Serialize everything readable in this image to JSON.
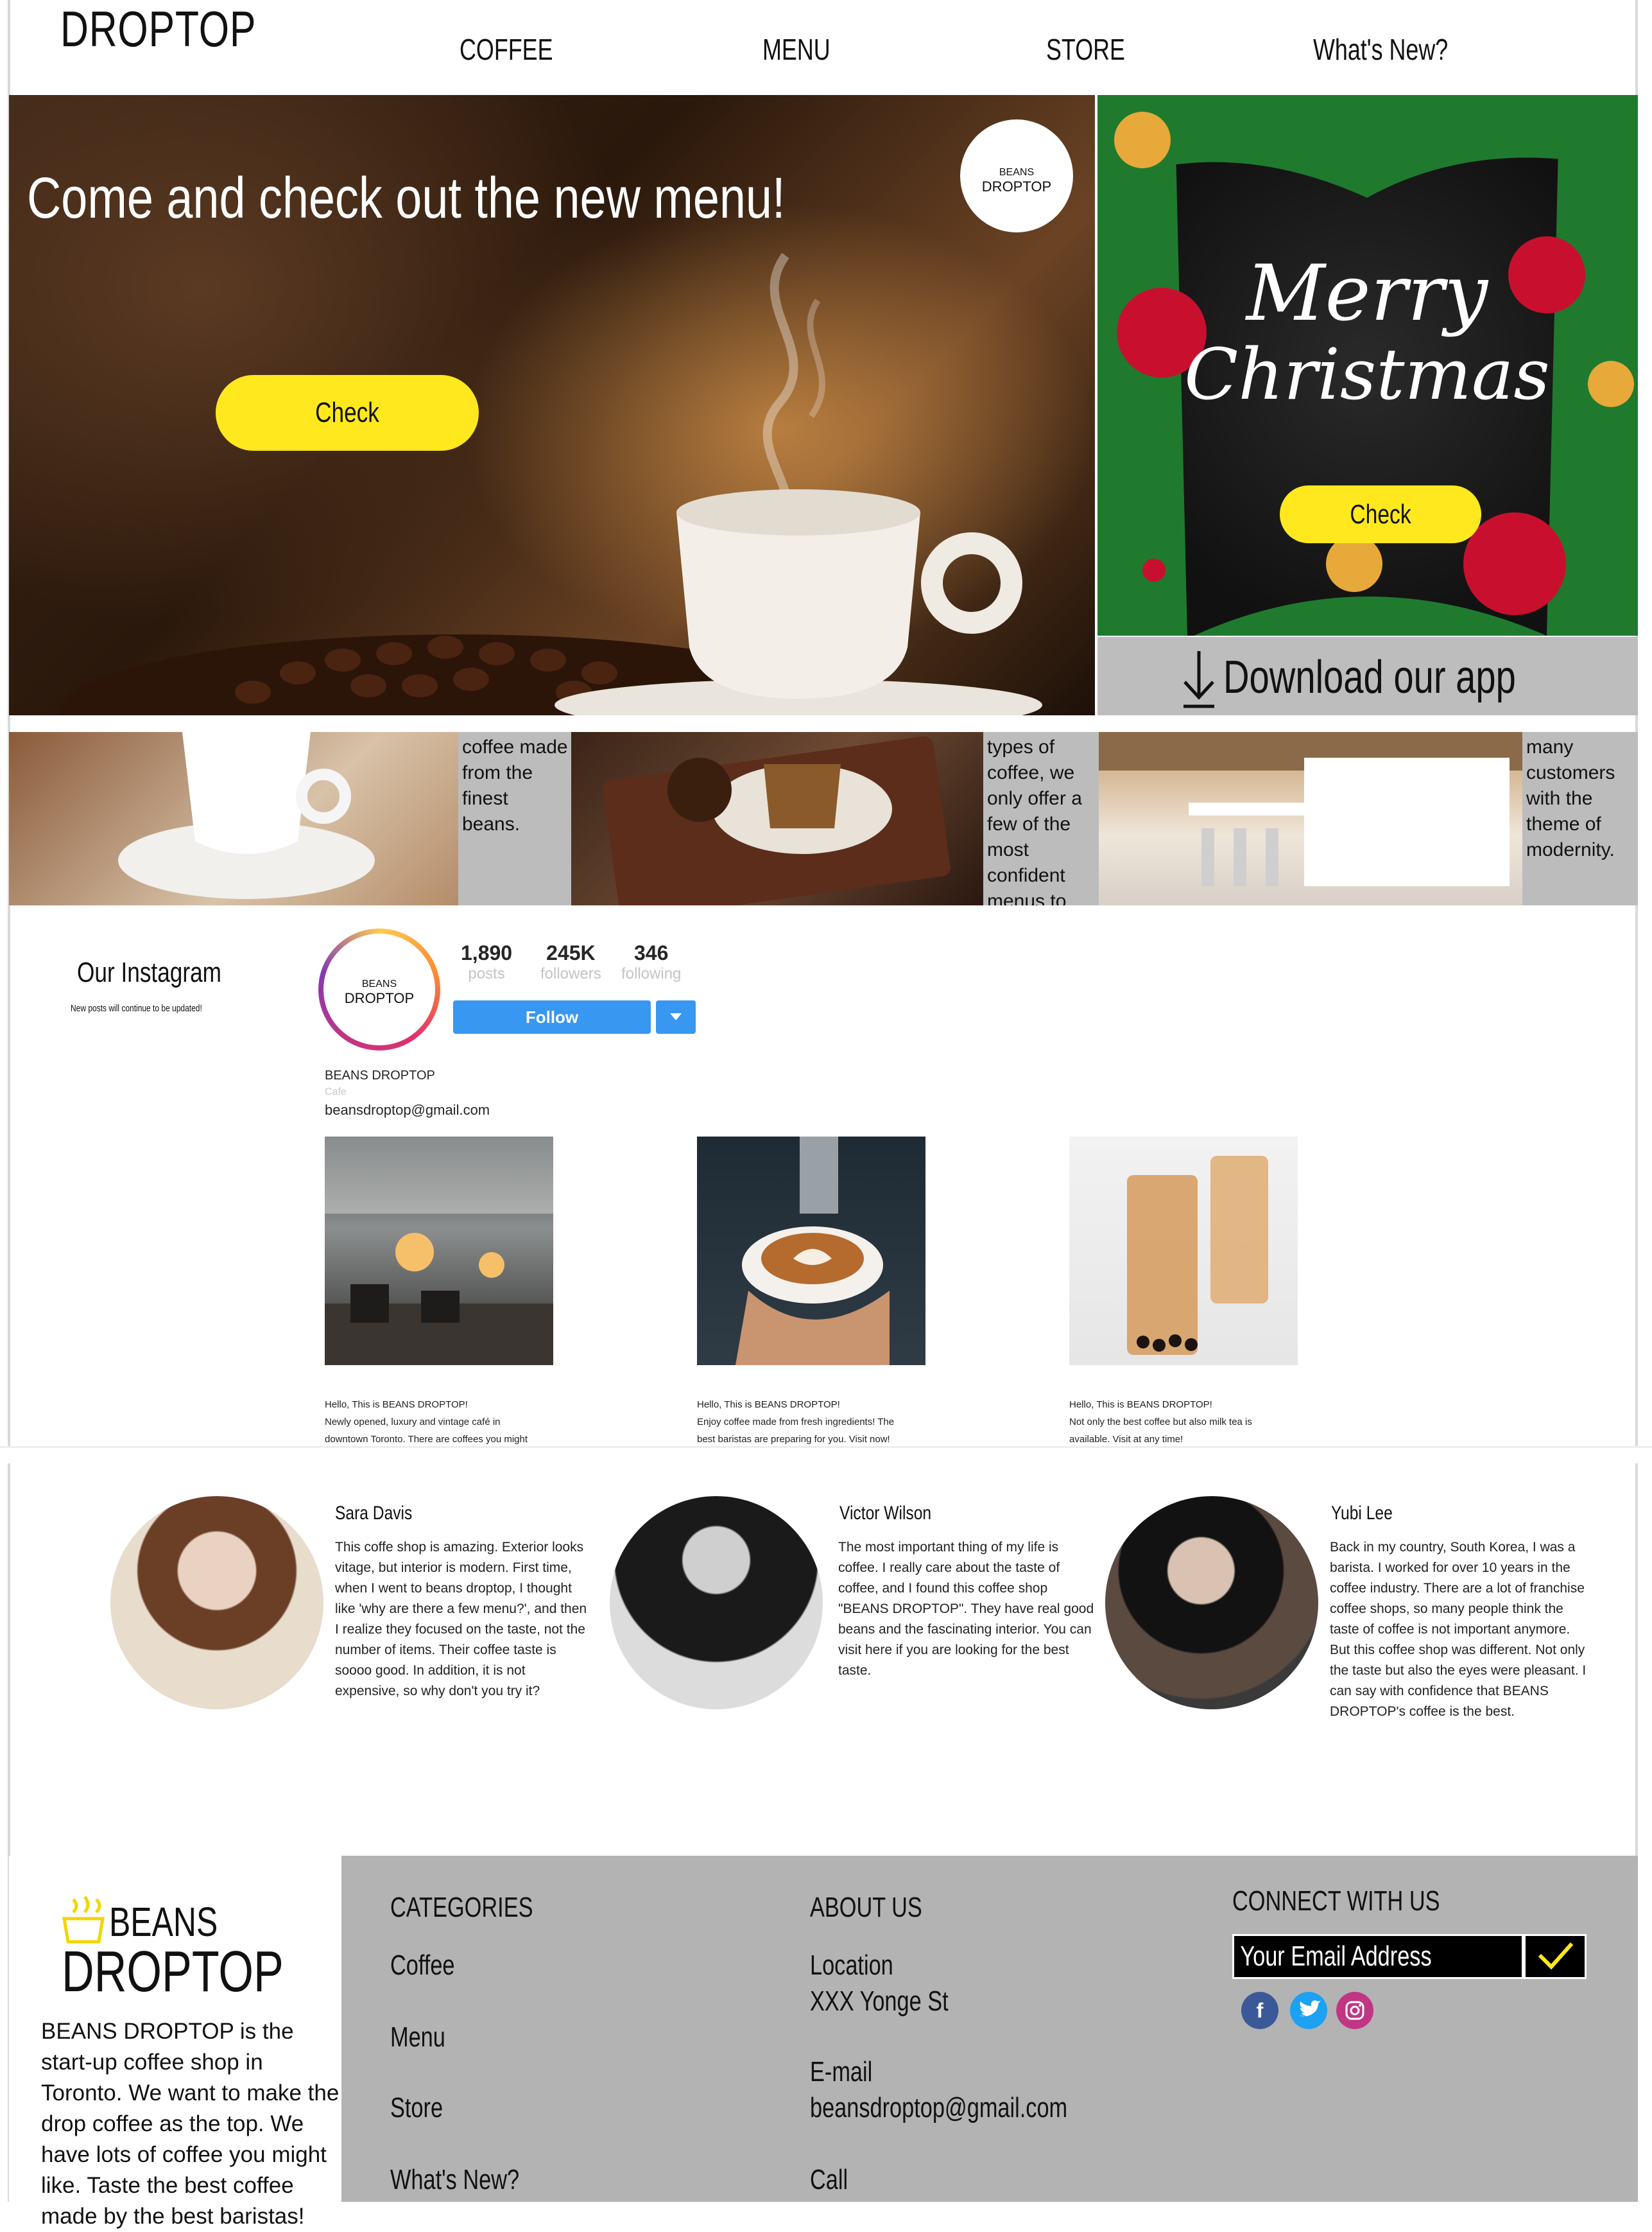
{
  "header": {
    "brand": "DROPTOP",
    "nav": [
      "COFFEE",
      "MENU",
      "STORE",
      "What's New?"
    ]
  },
  "hero": {
    "title": "Come and check out the new menu!",
    "check_label": "Check",
    "logo_top": "BEANS",
    "logo_bottom": "DROPTOP"
  },
  "xmas": {
    "line1": "Merry",
    "line2": "Christmas",
    "check_label": "Check"
  },
  "download": {
    "label": "Download our app",
    "icon": "arrow-down-icon"
  },
  "strip": [
    "coffee made from the finest beans.",
    "types of coffee, we only offer a few of the most confident menus to our guests.",
    "many customers with the theme of modernity."
  ],
  "instagram": {
    "title": "Our Instagram",
    "subtitle": "New posts will continue to be updated!",
    "profile_logo_top": "BEANS",
    "profile_logo_bottom": "DROPTOP",
    "stats": [
      {
        "value": "1,890",
        "label": "posts"
      },
      {
        "value": "245K",
        "label": "followers"
      },
      {
        "value": "346",
        "label": "following"
      }
    ],
    "follow_label": "Follow",
    "dropdown_icon": "caret-down-icon",
    "account_name": "BEANS DROPTOP",
    "category": "Cafe",
    "email": "beansdroptop@gmail.com",
    "posts": [
      {
        "caption": [
          "Hello, This is BEANS DROPTOP!",
          "Newly opened, luxury and vintage café in",
          "downtown Toronto. There are coffees you might"
        ]
      },
      {
        "caption": [
          "Hello, This is BEANS DROPTOP!",
          "Enjoy coffee made from fresh ingredients! The",
          "best baristas are preparing for you. Visit now!"
        ]
      },
      {
        "caption": [
          "Hello, This is BEANS DROPTOP!",
          "Not only the best coffee but also milk tea is",
          "available. Visit at any time!"
        ]
      }
    ]
  },
  "reviews": [
    {
      "name": "Sara Davis",
      "text": "This coffe shop is amazing. Exterior looks vitage, but interior is modern. First time, when I went to beans droptop, I thought like 'why are there a few menu?', and then I realize they focused on the taste, not the number of items. Their coffee taste is soooo good. In addition, it is not expensive, so why don't you try it?"
    },
    {
      "name": "Victor Wilson",
      "text": "The most important thing of my life is coffee. I really care about the taste of coffee, and I found this coffee shop \"BEANS DROPTOP\". They have real good beans and the fascinating interior. You can visit here if you are looking for the best taste."
    },
    {
      "name": "Yubi Lee",
      "text": "Back in my country, South Korea, I was a barista. I worked for over 10 years in the coffee industry. There are a lot of franchise coffee shops, so many people think the taste of coffee is not important anymore. But this coffee shop was different. Not only the taste but also the eyes were pleasant. I can say with confidence that BEANS DROPTOP's coffee is the best."
    }
  ],
  "footer": {
    "logo_top": "BEANS",
    "logo_bottom": "DROPTOP",
    "about": "BEANS DROPTOP is the start-up coffee shop in Toronto. We want to make the drop coffee as the top. We have lots of coffee you might like. Taste the best coffee made by the best baristas!",
    "categories_heading": "CATEGORIES",
    "categories": [
      "Coffee",
      "Menu",
      "Store",
      "What's New?"
    ],
    "about_heading": "ABOUT US",
    "location_label": "Location",
    "location_value": "XXX Yonge St",
    "email_label": "E-mail",
    "email_value": "beansdroptop@gmail.com",
    "call_label": "Call",
    "connect_heading": "CONNECT WITH US",
    "email_placeholder": "Your Email Address",
    "submit_icon": "checkmark-icon",
    "social": [
      "facebook-icon",
      "twitter-icon",
      "instagram-icon"
    ]
  },
  "colors": {
    "accent_yellow": "#ffe81e",
    "footer_gray": "#b3b3b3",
    "instagram_blue": "#3897f0",
    "facebook": "#3b5998",
    "twitter": "#1da1f2",
    "instagram": "#c13584"
  }
}
